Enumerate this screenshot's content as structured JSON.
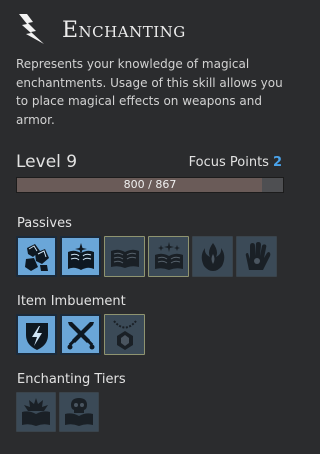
{
  "header": {
    "title": "Enchanting",
    "icon": "lightning-bolt-icon"
  },
  "description": "Represents your knowledge of magical enchantments. Usage of this skill allows you to place magical effects on weapons and armor.",
  "level": {
    "label": "Level 9",
    "focus_label": "Focus Points",
    "focus_value": "2"
  },
  "xp": {
    "text": "800 / 867",
    "current": 800,
    "max": 867
  },
  "sections": {
    "passives": {
      "label": "Passives",
      "items": [
        {
          "icon": "crystal-shards-icon",
          "state": "active"
        },
        {
          "icon": "glowing-book-icon",
          "state": "active"
        },
        {
          "icon": "open-book-icon",
          "state": "inactive-outlined"
        },
        {
          "icon": "sparkling-book-icon",
          "state": "inactive-outlined"
        },
        {
          "icon": "magic-flame-icon",
          "state": "inactive"
        },
        {
          "icon": "magic-hand-icon",
          "state": "inactive"
        }
      ]
    },
    "imbuement": {
      "label": "Item Imbuement",
      "items": [
        {
          "icon": "lightning-shield-icon",
          "state": "active"
        },
        {
          "icon": "crossed-swords-icon",
          "state": "active"
        },
        {
          "icon": "amulet-icon",
          "state": "inactive-outlined"
        }
      ]
    },
    "tiers": {
      "label": "Enchanting Tiers",
      "items": [
        {
          "icon": "burning-book-icon",
          "state": "inactive"
        },
        {
          "icon": "skull-book-icon",
          "state": "inactive"
        }
      ]
    }
  },
  "colors": {
    "background": "#2b2c2e",
    "active_tile": "#6aa6d8",
    "inactive_tile": "#3b4a57",
    "focus_accent": "#4aa3ea",
    "xp_fill": "#6a5b58",
    "xp_track": "#4e4f52"
  }
}
